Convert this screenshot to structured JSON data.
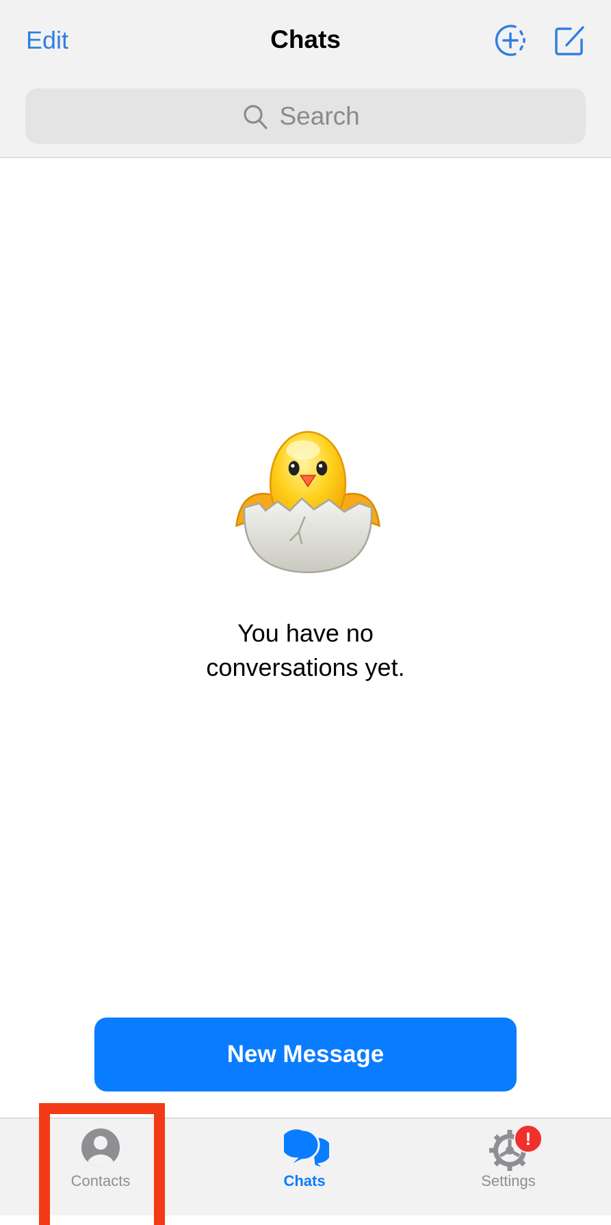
{
  "header": {
    "edit_label": "Edit",
    "title": "Chats",
    "new_story_icon": "circle-plus-dashed-icon",
    "compose_icon": "compose-icon"
  },
  "search": {
    "placeholder": "Search",
    "value": ""
  },
  "empty_state": {
    "icon": "hatching-chick",
    "line1": "You have no",
    "line2": "conversations yet."
  },
  "new_message_button": {
    "label": "New Message"
  },
  "tabbar": {
    "items": [
      {
        "label": "Contacts",
        "icon": "person-circle-icon",
        "active": false
      },
      {
        "label": "Chats",
        "icon": "chat-bubbles-icon",
        "active": true
      },
      {
        "label": "Settings",
        "icon": "gear-icon",
        "active": false,
        "badge": "!"
      }
    ]
  },
  "colors": {
    "accent": "#0a7cff",
    "highlight": "#f23a14",
    "badge": "#f0302e",
    "inactive": "#8e8e93"
  }
}
